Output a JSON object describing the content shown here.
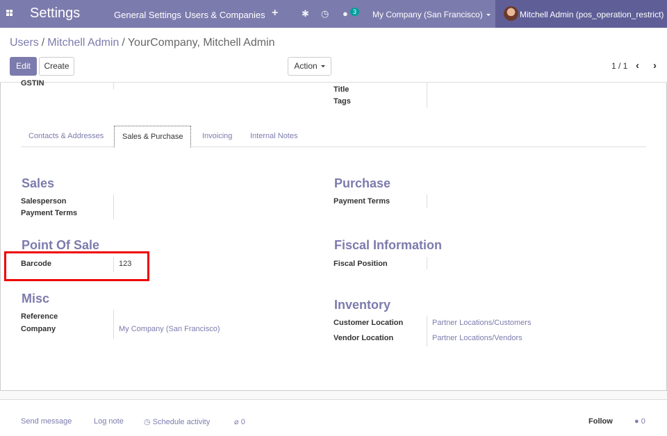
{
  "navbar": {
    "app_title": "Settings",
    "menu": [
      "General Settings",
      "Users & Companies"
    ],
    "plus_icon": "+",
    "bug_icon": "✱",
    "clock_icon": "◷",
    "chat_icon": "●",
    "chat_badge": "3",
    "company": "My Company (San Francisco)",
    "user": "Mitchell Admin (pos_operation_restrict)"
  },
  "breadcrumb": {
    "items": [
      "Users",
      "Mitchell Admin"
    ],
    "current": "YourCompany, Mitchell Admin"
  },
  "toolbar": {
    "edit": "Edit",
    "create": "Create",
    "action": "Action",
    "pager": "1 / 1"
  },
  "top_fields": {
    "gstin": "GSTIN",
    "title": "Title",
    "tags": "Tags"
  },
  "tabs": [
    "Contacts & Addresses",
    "Sales & Purchase",
    "Invoicing",
    "Internal Notes"
  ],
  "sales": {
    "heading": "Sales",
    "salesperson": "Salesperson",
    "payment_terms": "Payment Terms"
  },
  "purchase": {
    "heading": "Purchase",
    "payment_terms": "Payment Terms"
  },
  "pos": {
    "heading": "Point Of Sale",
    "barcode_label": "Barcode",
    "barcode_value": "123"
  },
  "fiscal": {
    "heading": "Fiscal Information",
    "position": "Fiscal Position"
  },
  "misc": {
    "heading": "Misc",
    "reference": "Reference",
    "company_label": "Company",
    "company_value": "My Company (San Francisco)"
  },
  "inventory": {
    "heading": "Inventory",
    "customer_label": "Customer Location",
    "customer_value": "Partner Locations/Customers",
    "vendor_label": "Vendor Location",
    "vendor_value": "Partner Locations/Vendors"
  },
  "chatter": {
    "send_message": "Send message",
    "log_note": "Log note",
    "schedule_activity": "Schedule activity",
    "attachments": "0",
    "follow": "Follow",
    "followers": "0"
  },
  "colors": {
    "brand": "#7c7bad",
    "user_area": "#5f5e97",
    "badge": "#00a09d",
    "highlight": "#e00000"
  }
}
